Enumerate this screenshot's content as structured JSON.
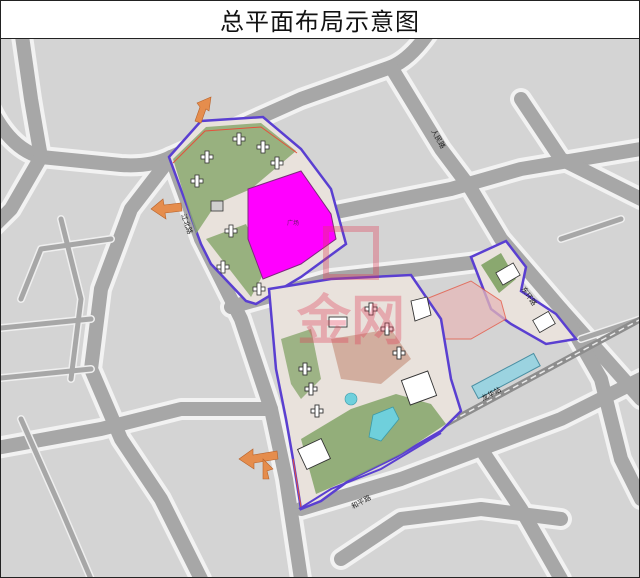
{
  "title": "总平面布局示意图",
  "road_labels": {
    "north_road": "人民路",
    "west_road": "江北路",
    "south_road": "和平路",
    "east_road": "东环路"
  },
  "station_label": "龙华站",
  "plaza_label": "广场",
  "watermark": "金网",
  "colors": {
    "block": "#d4d4d4",
    "road": "#a7a7a7",
    "road_edge": "#f2f2f2",
    "green": "#8aa86f",
    "green_dark": "#5f7f4d",
    "boundary": "#5a3fd1",
    "red_line": "#e6503c",
    "plaza": "#ff00ff",
    "arrow": "#e58d4d",
    "water": "#6fd0dc"
  }
}
